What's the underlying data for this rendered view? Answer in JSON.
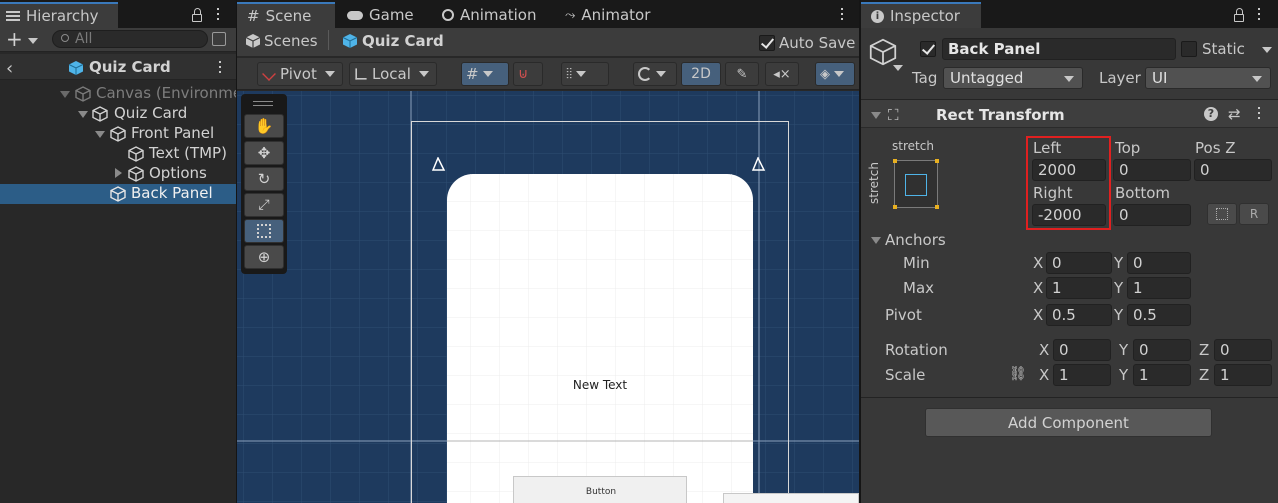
{
  "hierarchy": {
    "tab_label": "Hierarchy",
    "search_placeholder": "All",
    "breadcrumb": "Quiz Card",
    "items": [
      {
        "label": "Canvas (Environme"
      },
      {
        "label": "Quiz Card"
      },
      {
        "label": "Front Panel"
      },
      {
        "label": "Text (TMP)"
      },
      {
        "label": "Options"
      },
      {
        "label": "Back Panel"
      }
    ]
  },
  "scene": {
    "tabs": [
      {
        "label": "Scene"
      },
      {
        "label": "Game"
      },
      {
        "label": "Animation"
      },
      {
        "label": "Animator"
      }
    ],
    "breadcrumb_root": "Scenes",
    "breadcrumb_current": "Quiz Card",
    "auto_save_label": "Auto Save",
    "pivot_label": "Pivot",
    "local_label": "Local",
    "mode_2d_label": "2D",
    "canvas_text": "New Text",
    "button_text": "Button"
  },
  "inspector": {
    "tab_label": "Inspector",
    "object_name": "Back Panel",
    "static_label": "Static",
    "tag_label": "Tag",
    "tag_value": "Untagged",
    "layer_label": "Layer",
    "layer_value": "UI",
    "component_title": "Rect Transform",
    "anchor_h": "stretch",
    "anchor_v": "stretch",
    "fields": {
      "left_label": "Left",
      "left_value": "2000",
      "top_label": "Top",
      "top_value": "0",
      "posz_label": "Pos Z",
      "posz_value": "0",
      "right_label": "Right",
      "right_value": "-2000",
      "bottom_label": "Bottom",
      "bottom_value": "0"
    },
    "anchors": {
      "label": "Anchors",
      "min_label": "Min",
      "min_x": "0",
      "min_y": "0",
      "max_label": "Max",
      "max_x": "1",
      "max_y": "1"
    },
    "pivot": {
      "label": "Pivot",
      "x": "0.5",
      "y": "0.5"
    },
    "rotation": {
      "label": "Rotation",
      "x": "0",
      "y": "0",
      "z": "0"
    },
    "scale": {
      "label": "Scale",
      "x": "1",
      "y": "1",
      "z": "1"
    },
    "axis": {
      "x": "X",
      "y": "Y",
      "z": "Z"
    },
    "add_component_label": "Add Component",
    "highlight_color": "#e02020"
  },
  "colors": {
    "scene_bg": "#1e3a5e",
    "panel_bg": "#383838",
    "selection": "#2c5d87",
    "accent": "#3a79bb"
  }
}
